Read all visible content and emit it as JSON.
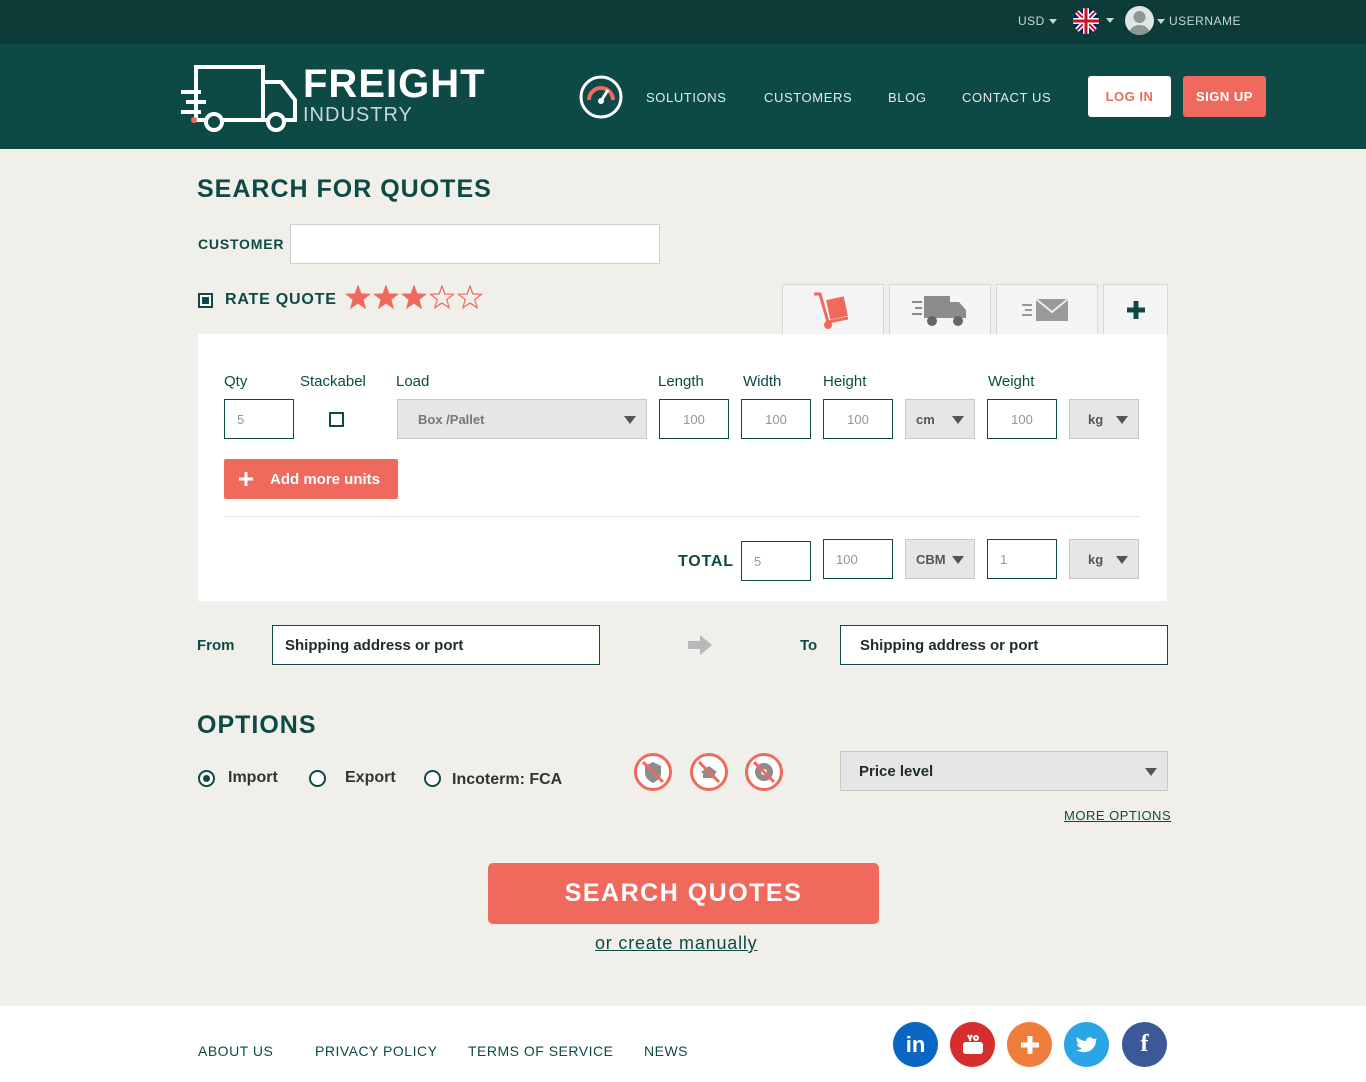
{
  "topbar": {
    "currency": "USD",
    "username": "USERNAME"
  },
  "header": {
    "logo_main": "FREIGHT",
    "logo_sub": "INDUSTRY",
    "nav": [
      "SOLUTIONS",
      "CUSTOMERS",
      "BLOG",
      "CONTACT US"
    ],
    "login": "LOG IN",
    "signup": "SIGN UP"
  },
  "search": {
    "title": "SEARCH FOR QUOTES",
    "customer_label": "CUSTOMER",
    "customer_value": "",
    "rate_label": "RATE QUOTE",
    "rating": 3,
    "rating_max": 5
  },
  "units": {
    "headers": {
      "qty": "Qty",
      "stack": "Stackabel",
      "load": "Load",
      "length": "Length",
      "width": "Width",
      "height": "Height",
      "weight": "Weight"
    },
    "row": {
      "qty": "5",
      "load": "Box /Pallet",
      "length": "100",
      "width": "100",
      "height": "100",
      "dim_unit": "cm",
      "weight": "100",
      "weight_unit": "kg"
    },
    "add_more": "Add more units",
    "total_label": "TOTAL",
    "total": {
      "qty": "5",
      "volume": "100",
      "volume_unit": "CBM",
      "weight": "1",
      "weight_unit": "kg"
    }
  },
  "route": {
    "from_label": "From",
    "from_value": "Shipping address or port",
    "to_label": "To",
    "to_value": "Shipping address or port"
  },
  "options": {
    "title": "OPTIONS",
    "import": "Import",
    "export": "Export",
    "incoterm": "Incoterm: FCA",
    "price_level": "Price level",
    "more_options": "MORE OPTIONS"
  },
  "actions": {
    "search": "SEARCH QUOTES",
    "manual": "or create manually"
  },
  "footer": {
    "links": [
      "ABOUT US",
      "PRIVACY POLICY",
      "TERMS OF SERVICE",
      "NEWS"
    ]
  },
  "colors": {
    "accent": "#ef6a5d",
    "primary": "#0d4a46",
    "dark": "#0c3b38"
  }
}
